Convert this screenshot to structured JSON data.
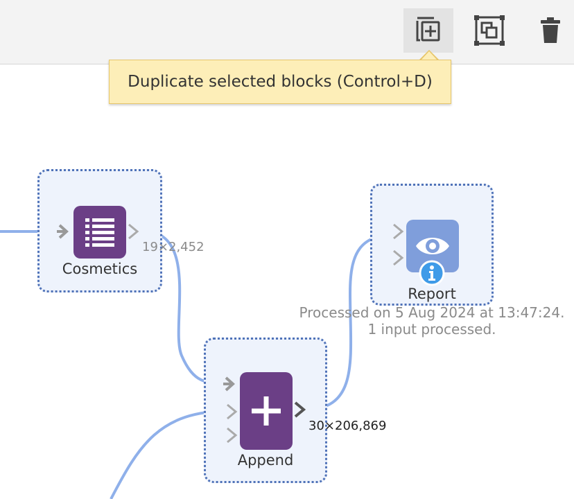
{
  "toolbar": {
    "buttons": [
      {
        "name": "duplicate",
        "icon": "duplicate-icon"
      },
      {
        "name": "group",
        "icon": "group-icon"
      },
      {
        "name": "delete",
        "icon": "trash-icon"
      }
    ]
  },
  "tooltip": {
    "text": "Duplicate selected blocks (Control+D)"
  },
  "nodes": {
    "cosmetics": {
      "label": "Cosmetics",
      "icon": "table-list-icon",
      "color": "#6b3f86",
      "output_size": "19×2,452"
    },
    "append": {
      "label": "Append",
      "icon": "plus-icon",
      "color": "#6b3f86",
      "output_size": "30×206,869"
    },
    "report": {
      "label": "Report",
      "icon": "eye-icon",
      "color": "#7f9edb",
      "badge_icon": "info-icon",
      "status_line1": "Processed on 5 Aug 2024 at 13:47:24.",
      "status_line2": "1 input processed."
    }
  },
  "colors": {
    "link": "#8fb0ea",
    "selection_border": "#4f72b8",
    "selection_fill": "#eef3fc",
    "port": "#9a9a9a",
    "info_badge": "#3f9be8"
  }
}
